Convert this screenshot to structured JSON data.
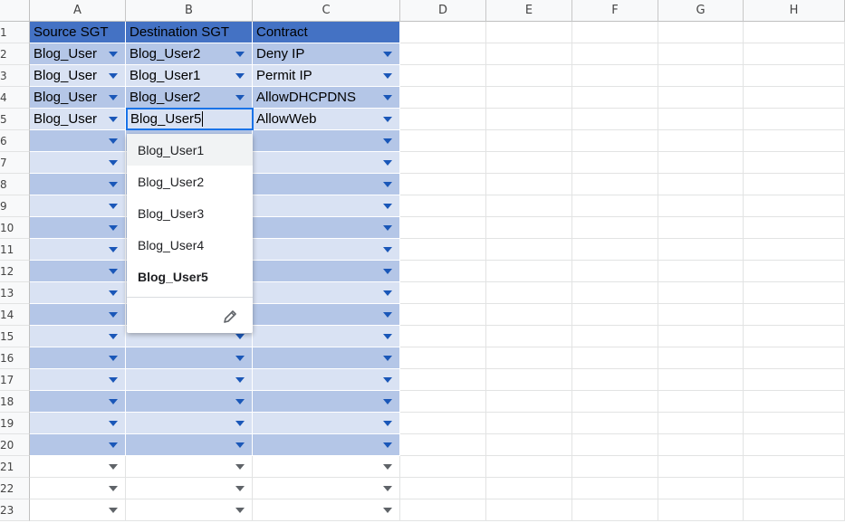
{
  "columns": [
    "A",
    "B",
    "C",
    "D",
    "E",
    "F",
    "G",
    "H"
  ],
  "rows": [
    "1",
    "2",
    "3",
    "4",
    "5",
    "6",
    "7",
    "8",
    "9",
    "10",
    "11",
    "12",
    "13",
    "14",
    "15",
    "16",
    "17",
    "18",
    "19",
    "20",
    "21",
    "22",
    "23"
  ],
  "headers": {
    "a": "Source SGT",
    "b": "Destination SGT",
    "c": "Contract"
  },
  "data": [
    {
      "a": "Blog_User",
      "b": "Blog_User2",
      "c": "Deny IP"
    },
    {
      "a": "Blog_User",
      "b": "Blog_User1",
      "c": "Permit IP"
    },
    {
      "a": "Blog_User",
      "b": "Blog_User2",
      "c": "AllowDHCPDNS"
    },
    {
      "a": "Blog_User",
      "b": "Blog_User5",
      "c": "AllowWeb"
    }
  ],
  "dropdown": {
    "options": [
      "Blog_User1",
      "Blog_User2",
      "Blog_User3",
      "Blog_User4",
      "Blog_User5"
    ],
    "selected": "Blog_User5",
    "hovered": "Blog_User1",
    "edit_icon": "pencil-icon"
  },
  "colors": {
    "header_fill": "#4472c4",
    "band_dark": "#b4c6e7",
    "band_light": "#d9e2f3",
    "selection": "#1a73e8",
    "dropdown_arrow": "#1a57b8"
  }
}
